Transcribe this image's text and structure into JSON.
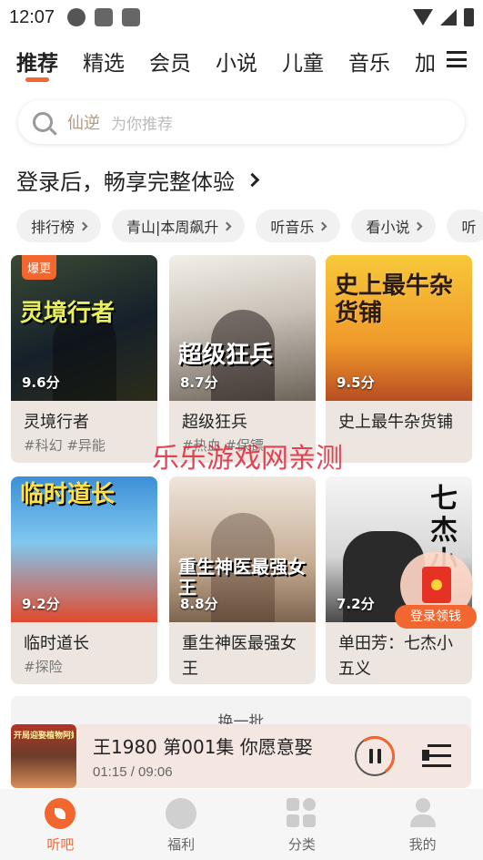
{
  "status_bar": {
    "time": "12:07"
  },
  "tabs": [
    {
      "label": "推荐",
      "active": true
    },
    {
      "label": "精选"
    },
    {
      "label": "会员"
    },
    {
      "label": "小说"
    },
    {
      "label": "儿童"
    },
    {
      "label": "音乐"
    },
    {
      "label": "加"
    }
  ],
  "search": {
    "hot_word": "仙逆",
    "placeholder": "为你推荐"
  },
  "login_banner": {
    "text": "登录后，畅享完整体验"
  },
  "chips": [
    "排行榜",
    "青山|本周飙升",
    "听音乐",
    "看小说",
    "听"
  ],
  "cards": [
    {
      "name": "灵境行者",
      "tags": "#科幻 #异能",
      "score": "9.6分",
      "badge": "爆更",
      "cover_text": "灵境行者"
    },
    {
      "name": "超级狂兵",
      "tags": "#热血 #保镖",
      "score": "8.7分",
      "cover_text": "超级狂兵"
    },
    {
      "name": "史上最牛杂货铺",
      "tags": "",
      "score": "9.5分",
      "cover_text": "史上最牛杂货铺"
    },
    {
      "name": "临时道长",
      "tags": "#探险",
      "score": "9.2分",
      "cover_text": "临时道长"
    },
    {
      "name": "重生神医最强女王",
      "tags": "",
      "score": "8.8分",
      "cover_text": "重生神医最强女王"
    },
    {
      "name": "单田芳：七杰小五义",
      "tags": "",
      "score": "7.2分",
      "cover_text": "七杰小"
    }
  ],
  "refresh_label": "换一批",
  "float_gift": {
    "label": "登录领钱"
  },
  "watermark": "乐乐游戏网亲测",
  "player": {
    "title": "王1980 第001集 你愿意娶",
    "time": "01:15 / 09:06",
    "thumb_text": "开局迎娶植物阿姨"
  },
  "bottom_nav": [
    {
      "label": "听吧",
      "active": true,
      "icon": "leaf-icon"
    },
    {
      "label": "福利",
      "icon": "diamond-icon"
    },
    {
      "label": "分类",
      "icon": "grid-icon"
    },
    {
      "label": "我的",
      "icon": "person-icon"
    }
  ],
  "colors": {
    "accent": "#f2672f",
    "watermark": "#e0263a"
  }
}
